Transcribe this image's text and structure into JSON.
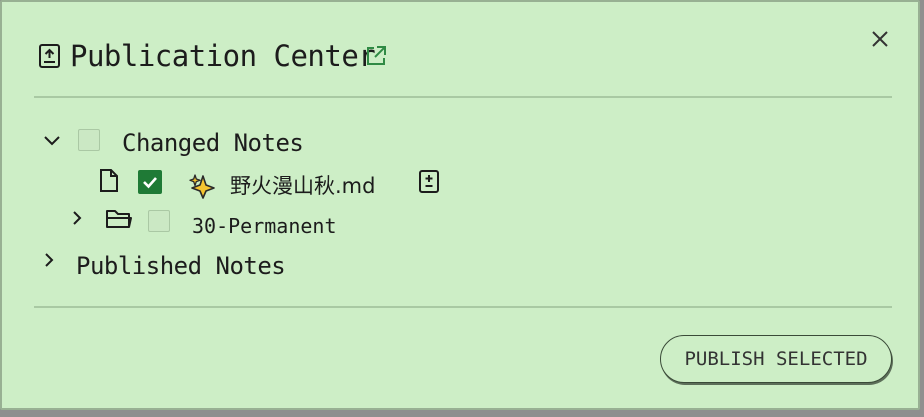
{
  "modal": {
    "title": "Publication Center",
    "close_icon": "close-icon",
    "title_icon": "upload-file-icon",
    "external_link_icon": "external-link-icon"
  },
  "tree": {
    "changed_notes": {
      "label": "Changed Notes",
      "expanded": true,
      "checked": false,
      "items": [
        {
          "name": "野火漫山秋.md",
          "emoji": "✨",
          "checked": true,
          "type": "file",
          "status_icon": "diff-file-icon"
        }
      ],
      "folders": [
        {
          "name": "30-Permanent",
          "expanded": false,
          "checked": false
        }
      ]
    },
    "published_notes": {
      "label": "Published Notes",
      "expanded": false
    }
  },
  "footer": {
    "publish_label": "PUBLISH SELECTED"
  },
  "colors": {
    "background": "#cdeec6",
    "checkbox_checked": "#1f7a36",
    "divider": "#a9c9a3"
  }
}
